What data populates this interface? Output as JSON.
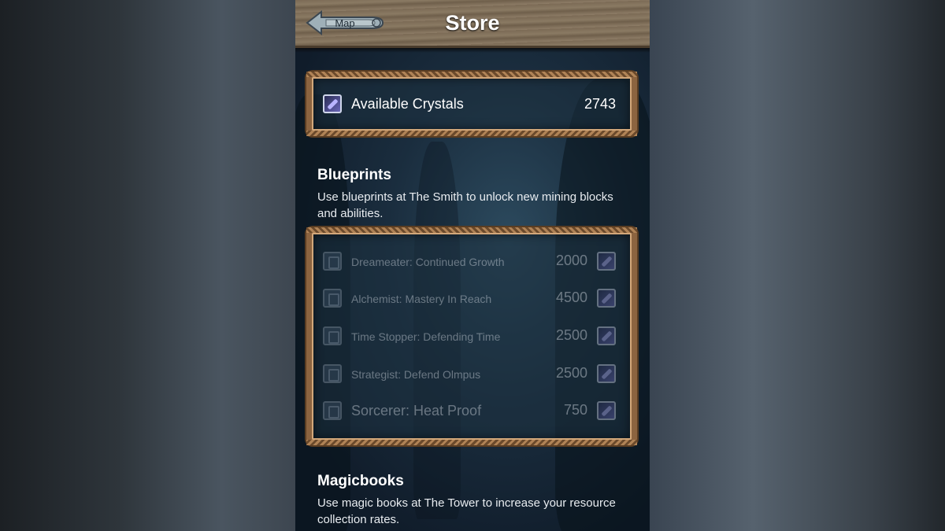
{
  "header": {
    "back_label": "Map",
    "title": "Store"
  },
  "crystals": {
    "label": "Available Crystals",
    "value": "2743",
    "icon": "crystal-icon"
  },
  "blueprints": {
    "title": "Blueprints",
    "description": "Use blueprints at The Smith to unlock new mining blocks and abilities.",
    "items": [
      {
        "name": "Dreameater: Continued Growth",
        "price": "2000",
        "icon": "scroll-icon"
      },
      {
        "name": "Alchemist: Mastery In Reach",
        "price": "4500",
        "icon": "scroll-icon"
      },
      {
        "name": "Time Stopper: Defending Time",
        "price": "2500",
        "icon": "scroll-icon"
      },
      {
        "name": "Strategist: Defend Olmpus",
        "price": "2500",
        "icon": "scroll-icon"
      },
      {
        "name": "Sorcerer: Heat Proof",
        "price": "750",
        "icon": "scroll-icon"
      }
    ]
  },
  "magicbooks": {
    "title": "Magicbooks",
    "description": "Use magic books at The Tower to increase your resource collection rates."
  },
  "colors": {
    "frame": "#8c6440",
    "header_wood": "#7b6a55",
    "crystal": "#6a66b8"
  }
}
